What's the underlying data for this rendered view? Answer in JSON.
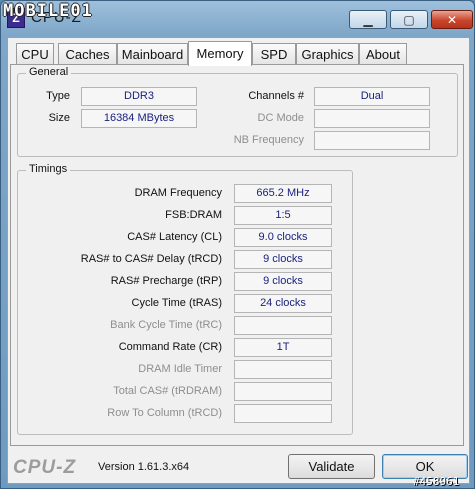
{
  "window": {
    "title": "CPU-Z",
    "watermark": "MOBILE01",
    "icon_glyph": "Z",
    "minimize_glyph": "▁",
    "maximize_glyph": "▢",
    "close_glyph": "✕"
  },
  "tabs": [
    {
      "label": "CPU"
    },
    {
      "label": "Caches"
    },
    {
      "label": "Mainboard"
    },
    {
      "label": "Memory",
      "active": true
    },
    {
      "label": "SPD"
    },
    {
      "label": "Graphics"
    },
    {
      "label": "About"
    }
  ],
  "general": {
    "legend": "General",
    "type_label": "Type",
    "type_value": "DDR3",
    "size_label": "Size",
    "size_value": "16384 MBytes",
    "channels_label": "Channels #",
    "channels_value": "Dual",
    "dc_mode_label": "DC Mode",
    "dc_mode_value": "",
    "nb_freq_label": "NB Frequency",
    "nb_freq_value": ""
  },
  "timings": {
    "legend": "Timings",
    "rows": [
      {
        "label": "DRAM Frequency",
        "value": "665.2 MHz",
        "enabled": true
      },
      {
        "label": "FSB:DRAM",
        "value": "1:5",
        "enabled": true
      },
      {
        "label": "CAS# Latency (CL)",
        "value": "9.0 clocks",
        "enabled": true
      },
      {
        "label": "RAS# to CAS# Delay (tRCD)",
        "value": "9 clocks",
        "enabled": true
      },
      {
        "label": "RAS# Precharge (tRP)",
        "value": "9 clocks",
        "enabled": true
      },
      {
        "label": "Cycle Time (tRAS)",
        "value": "24 clocks",
        "enabled": true
      },
      {
        "label": "Bank Cycle Time (tRC)",
        "value": "",
        "enabled": false
      },
      {
        "label": "Command Rate (CR)",
        "value": "1T",
        "enabled": true
      },
      {
        "label": "DRAM Idle Timer",
        "value": "",
        "enabled": false
      },
      {
        "label": "Total CAS# (tRDRAM)",
        "value": "",
        "enabled": false
      },
      {
        "label": "Row To Column (tRCD)",
        "value": "",
        "enabled": false
      }
    ]
  },
  "footer": {
    "brand": "CPU-Z",
    "version": "Version 1.61.3.x64",
    "validate_label": "Validate",
    "ok_label": "OK",
    "photo_id": "#458961"
  }
}
